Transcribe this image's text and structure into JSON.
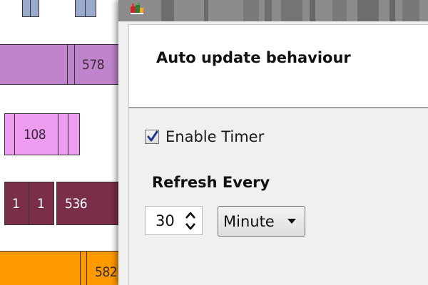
{
  "background_app": {
    "blocks": [
      {
        "label": "",
        "color": "#9aaacb"
      },
      {
        "label": "",
        "color": "#9aaacb"
      },
      {
        "label": "578",
        "color": "#c084cc"
      },
      {
        "label": "108",
        "color": "#ee9cf0"
      },
      {
        "label": "1",
        "color": "#7a2e4a"
      },
      {
        "label": "1",
        "color": "#7a2e4a"
      },
      {
        "label": "536",
        "color": "#7a2e4a"
      },
      {
        "label": "582",
        "color": "#ff9a00"
      }
    ]
  },
  "dialog": {
    "header_title": "Auto update behaviour",
    "enable_timer": {
      "label": "Enable Timer",
      "checked": true
    },
    "refresh": {
      "label": "Refresh Every",
      "value": "30",
      "unit": "Minute"
    }
  },
  "colors": {
    "dialog_bg": "#f0f0f0",
    "accent_check": "#1b3a8c"
  }
}
